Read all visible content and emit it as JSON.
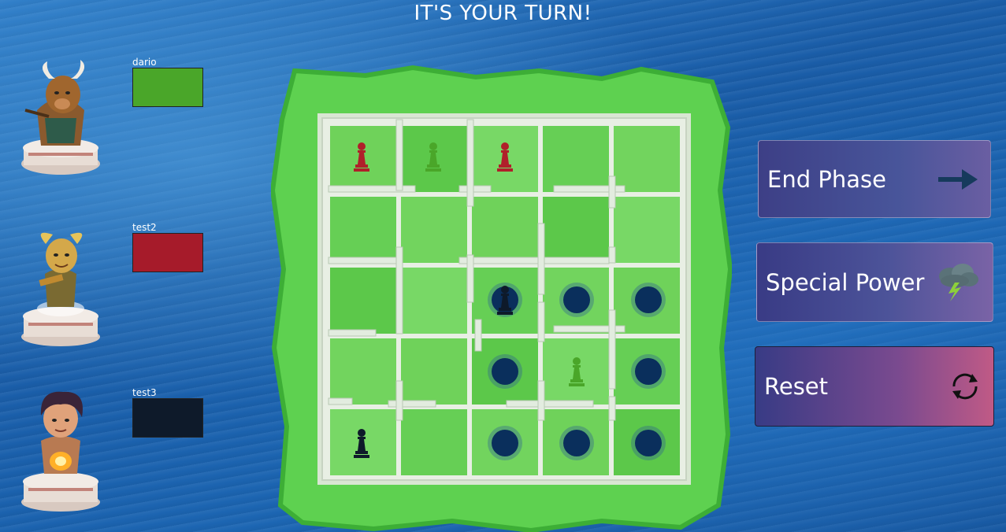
{
  "header": {
    "turn_text": "IT'S YOUR TURN!"
  },
  "players": [
    {
      "name": "dario",
      "color": "#4aa629",
      "avatar": "minotaur-avatar"
    },
    {
      "name": "test2",
      "color": "#a61b2a",
      "avatar": "pan-avatar"
    },
    {
      "name": "test3",
      "color": "#0e1a2a",
      "avatar": "prometheus-avatar"
    }
  ],
  "board": {
    "size": 5,
    "pieces": [
      {
        "row": 0,
        "col": 0,
        "color": "#b0202a",
        "name": "red-pawn"
      },
      {
        "row": 0,
        "col": 1,
        "color": "#4aa629",
        "name": "green-pawn"
      },
      {
        "row": 0,
        "col": 2,
        "color": "#b0202a",
        "name": "red-pawn"
      },
      {
        "row": 2,
        "col": 2,
        "color": "#0e1a2a",
        "name": "black-pawn"
      },
      {
        "row": 3,
        "col": 3,
        "color": "#4aa629",
        "name": "green-pawn"
      },
      {
        "row": 4,
        "col": 0,
        "color": "#0e1a2a",
        "name": "black-pawn"
      }
    ],
    "moves": [
      {
        "row": 2,
        "col": 2
      },
      {
        "row": 2,
        "col": 3
      },
      {
        "row": 2,
        "col": 4
      },
      {
        "row": 3,
        "col": 2
      },
      {
        "row": 3,
        "col": 4
      },
      {
        "row": 4,
        "col": 2
      },
      {
        "row": 4,
        "col": 3
      },
      {
        "row": 4,
        "col": 4
      }
    ],
    "move_marker_color": "#0a2f5c"
  },
  "actions": {
    "end_phase": {
      "label": "End Phase",
      "icon": "arrow-right-icon"
    },
    "special_power": {
      "label": "Special Power",
      "icon": "storm-cloud-icon"
    },
    "reset": {
      "label": "Reset",
      "icon": "refresh-icon"
    }
  }
}
